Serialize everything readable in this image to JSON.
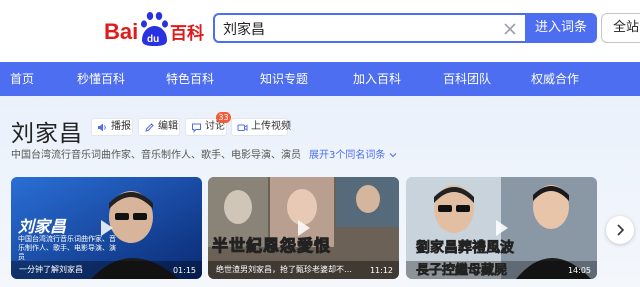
{
  "header": {
    "logo": {
      "text_left": "Bai",
      "text_paw": "du",
      "text_right": "百科"
    },
    "search": {
      "value": "刘家昌"
    },
    "submit_label": "进入词条",
    "global_label": "全站"
  },
  "nav": {
    "items": [
      "首页",
      "秒懂百科",
      "特色百科",
      "知识专题",
      "加入百科",
      "百科团队",
      "权威合作"
    ]
  },
  "entry": {
    "title": "刘家昌",
    "actions": {
      "broadcast": "播报",
      "edit": "编辑",
      "discuss": "讨论",
      "discuss_count": "33",
      "upload_video": "上传视频"
    },
    "description": "中国台湾流行音乐词曲作家、音乐制作人、歌手、电影导演、演员",
    "expand_link": "展开3个同名词条"
  },
  "videos": [
    {
      "caption": "一分钟了解刘家昌",
      "duration": "01:15",
      "overlay_title": "刘家昌",
      "overlay_text": "中国台湾流行音乐词曲作家、音乐制作人、歌手、电影导演、演员"
    },
    {
      "caption": "绝世渣男刘家昌，抢了甄珍老婆却不…",
      "duration": "11:12",
      "overlay_title": "半世紀恩怨愛恨"
    },
    {
      "caption": "",
      "duration": "14:05",
      "overlay_title": "劉家昌葬禮風波",
      "overlay_text2": "長子控繼母藏屍"
    }
  ],
  "colors": {
    "brand_blue": "#4e6ef2",
    "logo_red": "#de1c1c",
    "badge_red": "#f35b3b"
  }
}
